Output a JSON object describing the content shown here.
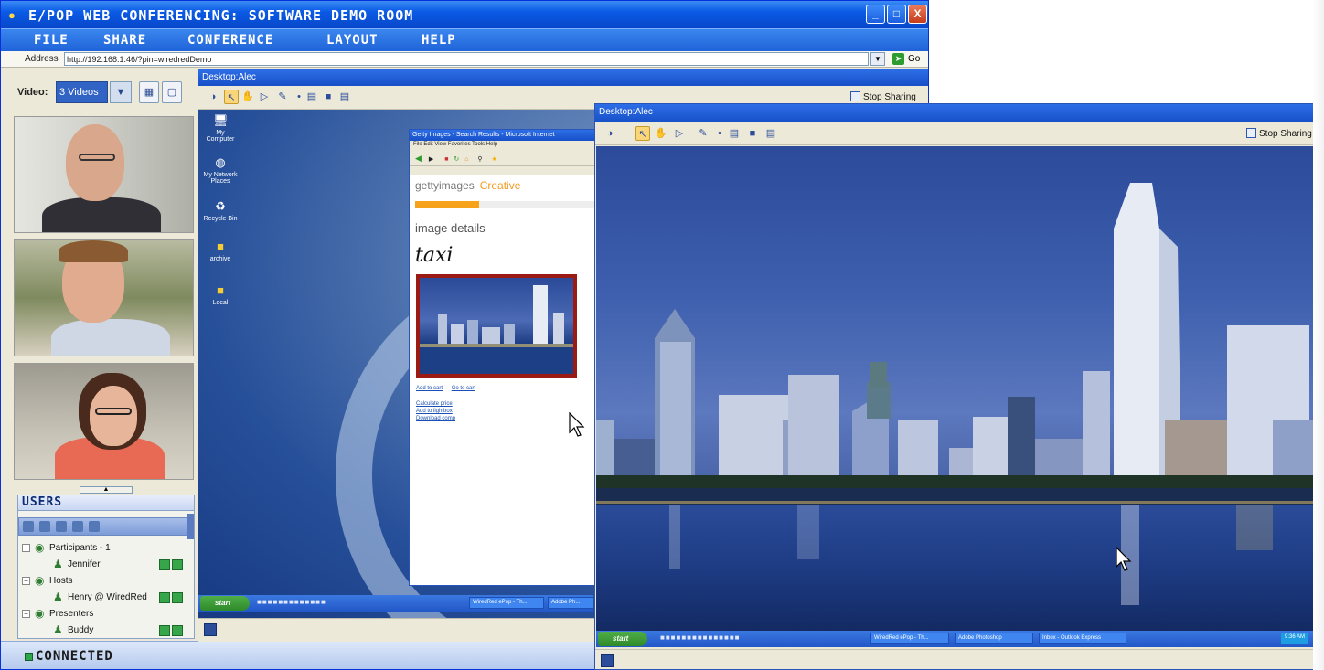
{
  "window": {
    "title": "E/POP WEB CONFERENCING: SOFTWARE DEMO ROOM",
    "controls": {
      "minimize": "_",
      "maximize": "□",
      "close": "X"
    }
  },
  "menu": [
    "FILE",
    "SHARE",
    "CONFERENCE",
    "LAYOUT",
    "HELP"
  ],
  "address_bar": {
    "label": "Address",
    "value": "http://192.168.1.46/?pin=wiredredDemo",
    "go_label": "Go"
  },
  "video": {
    "label": "Video:",
    "selected": "3 Videos"
  },
  "users": {
    "header": "USERS",
    "groups": [
      {
        "label": "Participants - 1",
        "members": [
          "Jennifer"
        ]
      },
      {
        "label": "Hosts",
        "members": [
          "Henry @ WiredRed"
        ]
      },
      {
        "label": "Presenters",
        "members": [
          "Buddy"
        ]
      }
    ]
  },
  "status": {
    "text": "CONNECTED",
    "color": "#2ea64a"
  },
  "share_back": {
    "title": "Desktop:Alec",
    "stop_label": "Stop Sharing",
    "desktop_icons": [
      "My Computer",
      "My Network Places",
      "Recycle Bin",
      "archive",
      "Local"
    ],
    "browser": {
      "title": "Getty Images - Search Results - Microsoft Internet",
      "menu": "File  Edit  View  Favorites  Tools  Help",
      "logo": "gettyimages",
      "logo_suffix": "Creative",
      "heading": "image details",
      "signature": "taxi",
      "links": [
        "Add to cart",
        "Go to cart"
      ],
      "lines": [
        "Calculate price",
        "Add to lightbox",
        "Download comp"
      ]
    },
    "taskbar": {
      "start": "start",
      "items": [
        "WiredRed ePop - Th...",
        "Adobe Ph..."
      ]
    }
  },
  "share_front": {
    "title": "Desktop:Alec",
    "stop_label": "Stop Sharing",
    "taskbar": {
      "start": "start",
      "items": [
        "WiredRed ePop - Th...",
        "Adobe Photoshop",
        "Inbox - Outlook Express"
      ],
      "tray_time": "9:36 AM"
    }
  },
  "colors": {
    "xp_blue": "#0a5ae6",
    "accent_orange": "#f39a1d",
    "frame_red": "#9b1a14"
  }
}
